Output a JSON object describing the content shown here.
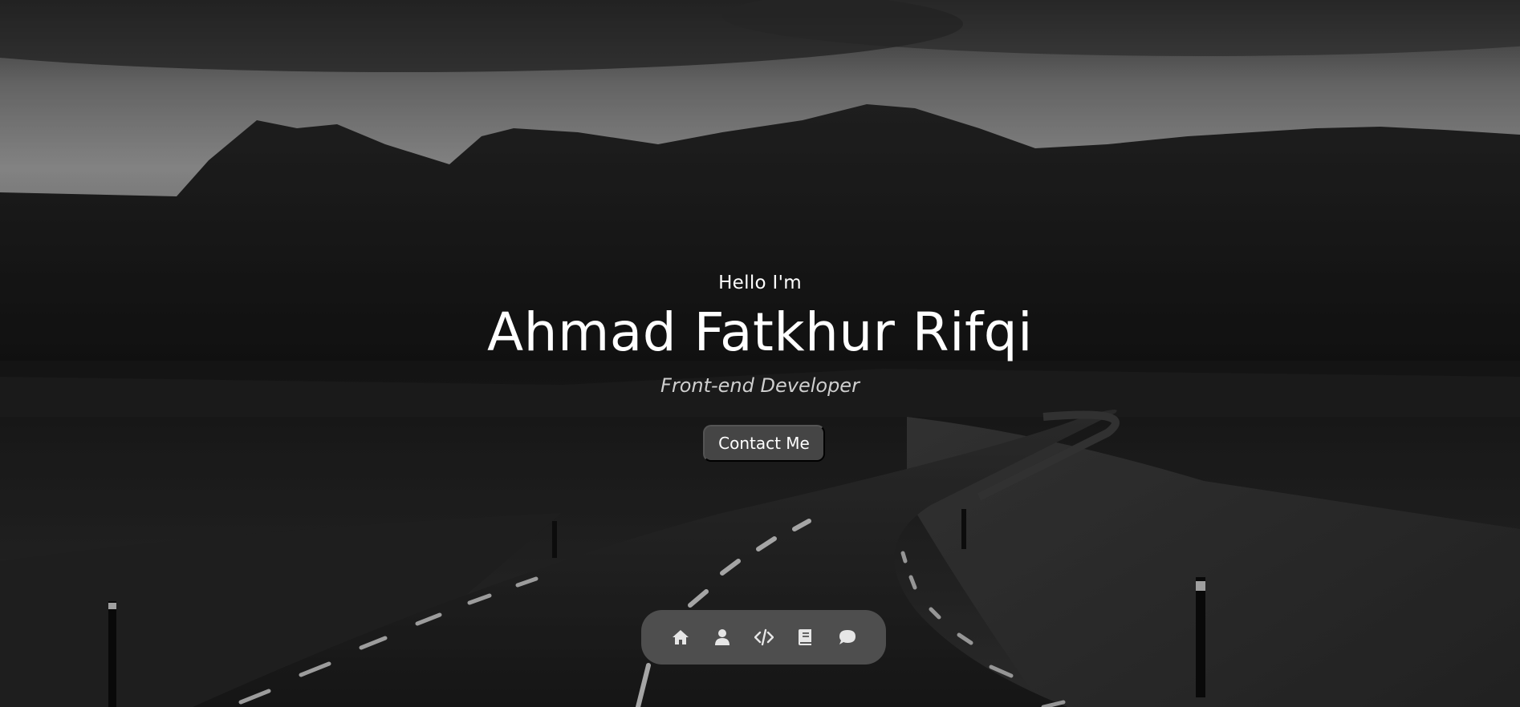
{
  "hero": {
    "greeting": "Hello I'm",
    "name": "Ahmad Fatkhur Rifqi",
    "role": "Front-end Developer",
    "contact_label": "Contact Me"
  },
  "nav": {
    "items": [
      {
        "icon": "home-icon"
      },
      {
        "icon": "user-icon"
      },
      {
        "icon": "code-icon"
      },
      {
        "icon": "book-icon"
      },
      {
        "icon": "chat-icon"
      }
    ]
  },
  "colors": {
    "text": "#ffffff",
    "button_bg": "#454545",
    "nav_bg": "#555555",
    "icon": "#e6e6e6"
  }
}
